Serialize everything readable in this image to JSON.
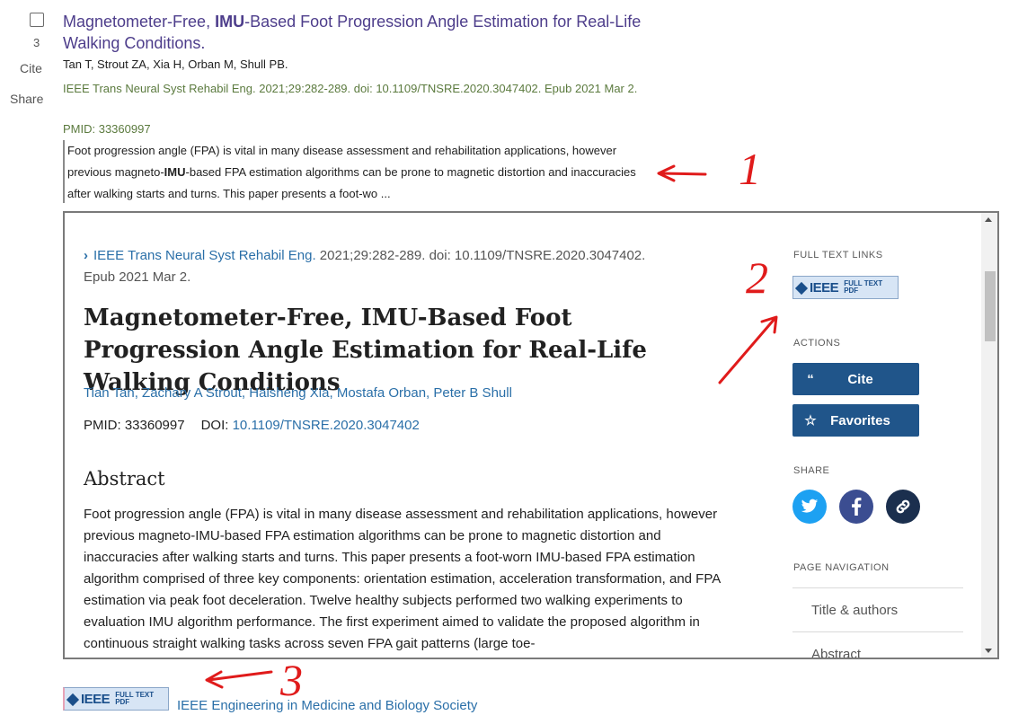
{
  "result": {
    "number": "3",
    "cite_label": "Cite",
    "share_label": "Share",
    "title_pre": "Magnetometer-Free, ",
    "title_bold": "IMU",
    "title_post": "-Based Foot Progression Angle Estimation for Real-Life Walking Conditions.",
    "authors": "Tan T, Strout ZA, Xia H, Orban M, Shull PB.",
    "citation": "IEEE Trans Neural Syst Rehabil Eng. 2021;29:282-289. doi: 10.1109/TNSRE.2020.3047402. Epub 2021 Mar 2.",
    "pmid": "PMID: 33360997",
    "snippet_1": "Foot progression angle (FPA) is vital in many disease assessment and rehabilitation applications, however previous magneto-",
    "snippet_bold": "IMU",
    "snippet_2": "-based FPA estimation algorithms can be prone to magnetic distortion and inaccuracies after walking starts and turns. This paper presents a foot-wo ..."
  },
  "annotations": {
    "one": "1",
    "two": "2",
    "three": "3"
  },
  "preview": {
    "journal": "IEEE Trans Neural Syst Rehabil Eng.",
    "journal_rest": "2021;29:282-289. doi: 10.1109/TNSRE.2020.3047402. Epub 2021 Mar 2.",
    "title": "Magnetometer-Free, IMU-Based Foot Progression Angle Estimation for Real-Life Walking Conditions",
    "authors": "Tian Tan, Zachary A Strout, Haisheng Xia, Mostafa Orban, Peter B Shull",
    "pmid": "PMID: 33360997",
    "doi_label": "DOI:",
    "doi": "10.1109/TNSRE.2020.3047402",
    "abstract_heading": "Abstract",
    "abstract": "Foot progression angle (FPA) is vital in many disease assessment and rehabilitation applications, however previous magneto-IMU-based FPA estimation algorithms can be prone to magnetic distortion and inaccuracies after walking starts and turns. This paper presents a foot-worn IMU-based FPA estimation algorithm comprised of three key components: orientation estimation, acceleration transformation, and FPA estimation via peak foot deceleration. Twelve healthy subjects performed two walking experiments to evaluation IMU algorithm performance. The first experiment aimed to validate the proposed algorithm in continuous straight walking tasks across seven FPA gait patterns (large toe-"
  },
  "sidebar": {
    "full_text_label": "FULL TEXT LINKS",
    "actions_label": "ACTIONS",
    "cite_button": "Cite",
    "favorites_button": "Favorites",
    "share_label": "SHARE",
    "page_nav_label": "PAGE NAVIGATION",
    "nav_items": [
      "Title & authors",
      "Abstract"
    ]
  },
  "badge": {
    "logo": "IEEE",
    "line1": "FULL TEXT",
    "line2": "PDF"
  },
  "bottom": {
    "link": "IEEE Engineering in Medicine and Biology Society"
  },
  "colors": {
    "accent": "#20558a",
    "link": "#2a6fa8",
    "visited": "#4d3d8b",
    "annotation": "#e01b1b",
    "twitter": "#1da1f2",
    "facebook": "#3b4d91",
    "permalink": "#1b2f4e"
  },
  "icons": {
    "cite": "quote-icon",
    "favorites": "star-icon",
    "twitter": "twitter-icon",
    "facebook": "facebook-icon",
    "permalink": "link-icon",
    "journal": "chevron-right-icon"
  }
}
